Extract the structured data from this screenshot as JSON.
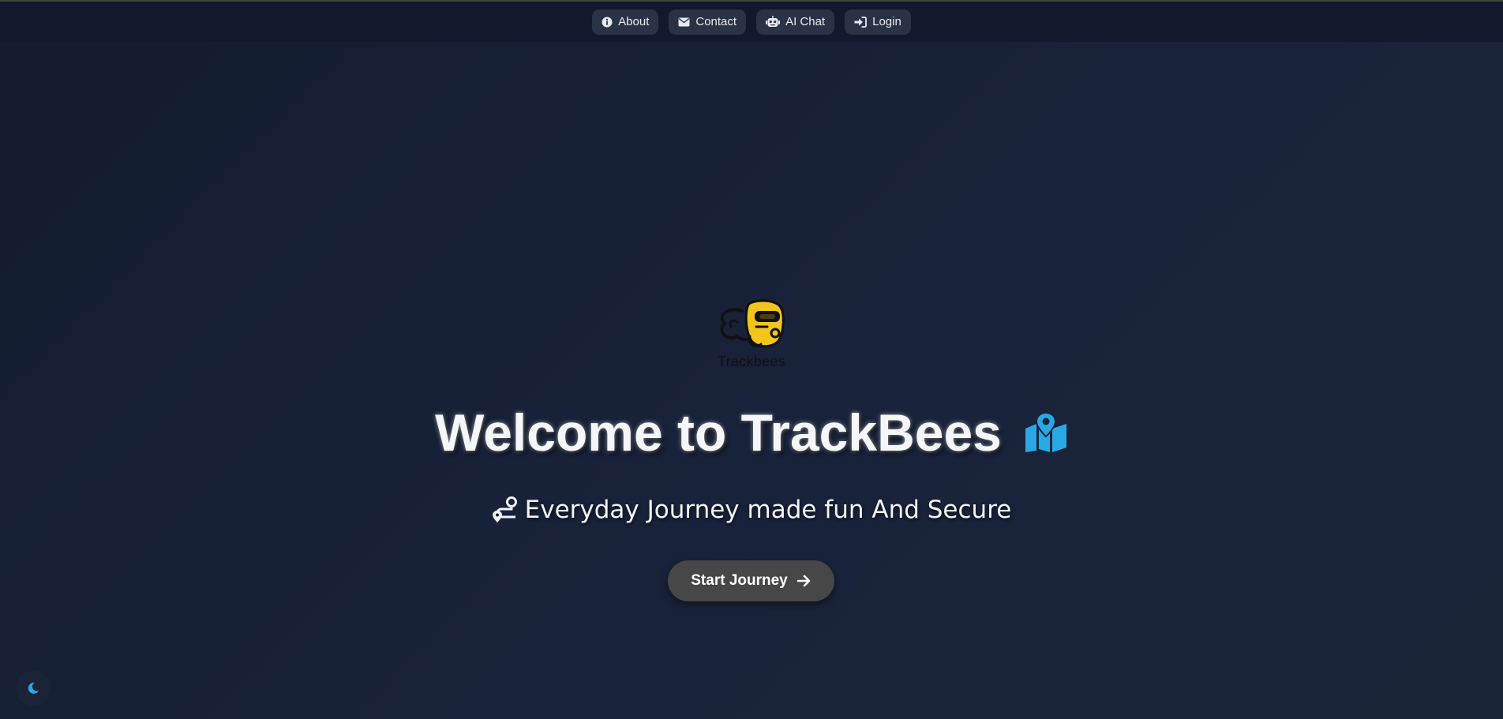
{
  "nav": {
    "items": [
      {
        "label": "About",
        "icon": "info-icon"
      },
      {
        "label": "Contact",
        "icon": "envelope-icon"
      },
      {
        "label": "AI Chat",
        "icon": "robot-icon"
      },
      {
        "label": "Login",
        "icon": "login-icon"
      }
    ]
  },
  "logo": {
    "text": "Trackbees",
    "icon": "bee-logo-icon"
  },
  "hero": {
    "title": "Welcome to TrackBees",
    "title_icon": "map-location-icon",
    "subtitle": "Everyday Journey made fun And Secure",
    "subtitle_icon": "route-icon",
    "cta_label": "Start Journey",
    "cta_icon": "arrow-right-icon"
  },
  "theme_toggle": {
    "icon": "moon-icon"
  },
  "colors": {
    "background": "#18223a",
    "navbar": "#111a2c",
    "nav_button": "#2a3346",
    "accent_blue": "#29a8e6",
    "logo_yellow": "#f3c51a",
    "cta_button": "#484747"
  }
}
